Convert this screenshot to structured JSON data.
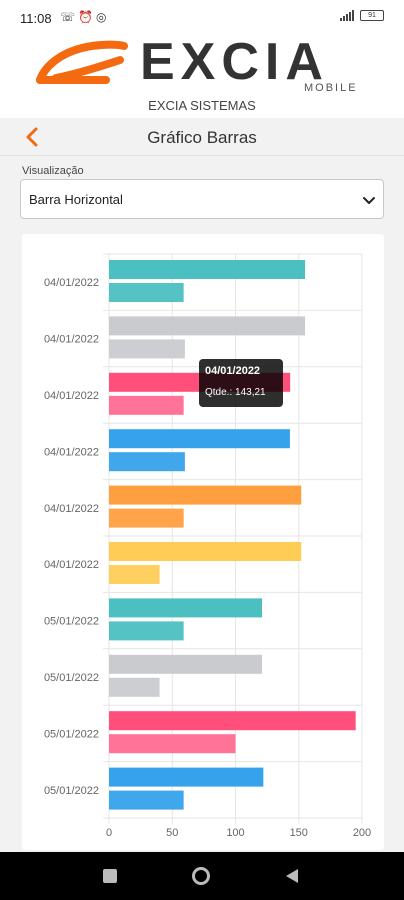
{
  "status": {
    "time": "11:08",
    "left_icons": [
      "missed-call-icon",
      "alarm-icon",
      "whatsapp-icon"
    ],
    "battery": "91"
  },
  "brand": {
    "name": "EXCIA",
    "tagline": "MOBILE",
    "caption": "EXCIA SISTEMAS",
    "accent": "#f36a10"
  },
  "header": {
    "title": "Gráfico Barras",
    "back_icon": "chevron-left-icon"
  },
  "visualization": {
    "label": "Visualização",
    "selected": "Barra Horizontal"
  },
  "tooltip": {
    "title": "04/01/2022",
    "body": "Qtde.: 143,21"
  },
  "chart_data": {
    "type": "bar",
    "orientation": "horizontal",
    "categories": [
      "04/01/2022",
      "04/01/2022",
      "04/01/2022",
      "04/01/2022",
      "04/01/2022",
      "04/01/2022",
      "05/01/2022",
      "05/01/2022",
      "05/01/2022",
      "05/01/2022"
    ],
    "series": [
      {
        "values": [
          155,
          155,
          143.21,
          143,
          152,
          152,
          121,
          121,
          195,
          122
        ]
      },
      {
        "values": [
          59,
          60,
          59,
          60,
          59,
          40,
          59,
          40,
          100,
          59
        ]
      }
    ],
    "colors": [
      "#4cc0c0",
      "#c9cbcf",
      "#ff4f7a",
      "#36a2eb",
      "#ff9f40",
      "#ffcd56",
      "#4cc0c0",
      "#c9cbcf",
      "#ff4f7a",
      "#36a2eb"
    ],
    "colors_light": [
      "#4cc0c0",
      "#c9cbcf",
      "#ff6b93",
      "#36a2eb",
      "#ff9f40",
      "#ffcd56",
      "#4cc0c0",
      "#c9cbcf",
      "#ff6b93",
      "#36a2eb"
    ],
    "xlim": [
      0,
      200
    ],
    "xticks": [
      0,
      50,
      100,
      150,
      200
    ],
    "grid": true
  },
  "navigation": {
    "buttons": [
      "recents-button",
      "home-button",
      "back-button"
    ]
  }
}
